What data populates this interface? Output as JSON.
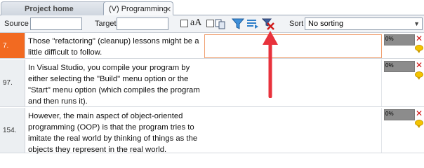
{
  "tabs": [
    {
      "label": "Project home",
      "active": false
    },
    {
      "label": "(V) Programming",
      "active": true
    }
  ],
  "toolbar": {
    "source_label": "Source",
    "source_value": "",
    "target_label": "Target",
    "target_value": "",
    "case_label": "aA",
    "sort_label": "Sort",
    "sort_value": "No sorting"
  },
  "rows": [
    {
      "number": "7.",
      "selected": true,
      "source": "Those \"refactoring\" (cleanup) lessons might be a little difficult to follow.",
      "target": "",
      "progress": "0%"
    },
    {
      "number": "97.",
      "selected": false,
      "source": "In Visual Studio, you compile your program by either selecting the \"Build\" menu option or the \"Start\" menu option (which compiles the program and then runs it).",
      "target": "",
      "progress": "0%"
    },
    {
      "number": "154.",
      "selected": false,
      "source": "However, the main aspect of object-oriented programming (OOP) is that the program tries to imitate the real world by thinking of things as the objects they represent in the real world.",
      "target": "",
      "progress": "0%"
    }
  ],
  "colors": {
    "selected_row": "#f26a21",
    "annotation_arrow": "#e8323c",
    "delete_icon": "#d01010",
    "comment_icon": "#f4c400"
  },
  "icons": [
    "case-sensitive-checkbox",
    "copy-icon",
    "filter-icon",
    "filter-list-icon",
    "clear-filter-icon",
    "delete-icon",
    "comment-icon"
  ]
}
